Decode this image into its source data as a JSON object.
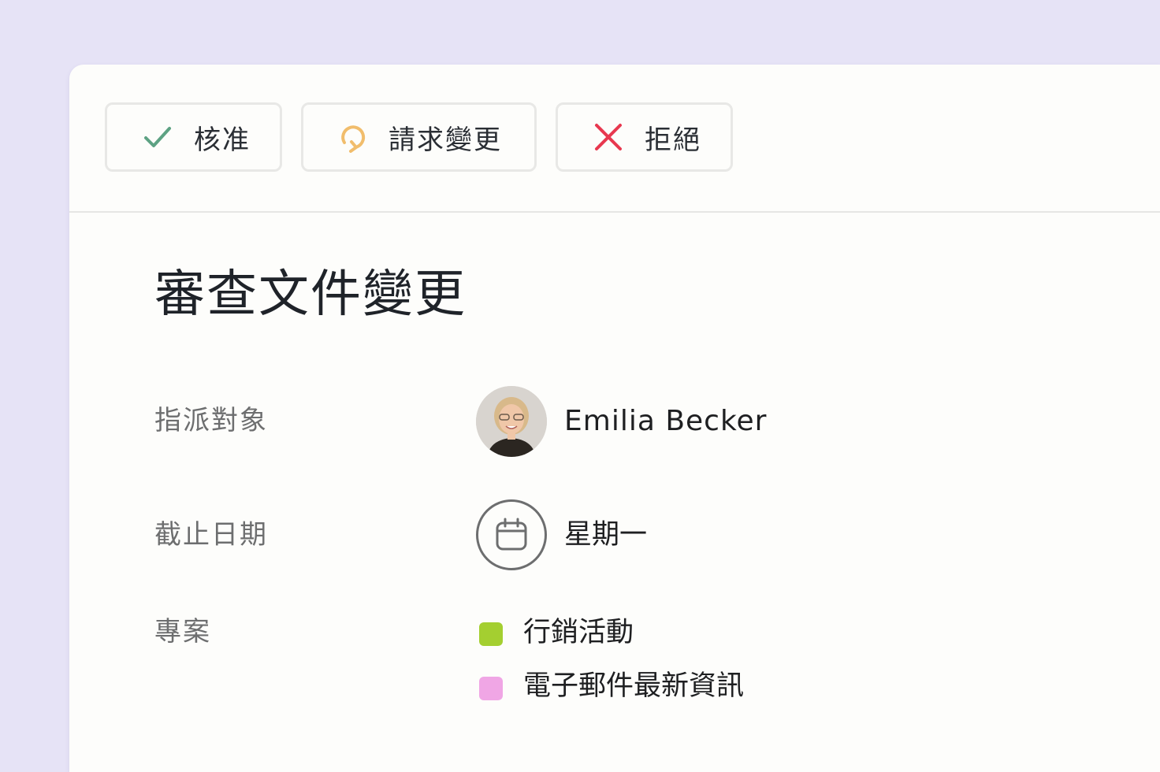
{
  "toolbar": {
    "approve_label": "核准",
    "approve_icon": "check-icon",
    "approve_color": "#5da283",
    "request_changes_label": "請求變更",
    "request_changes_icon": "refresh-icon",
    "request_changes_color": "#f1bd6c",
    "reject_label": "拒絕",
    "reject_icon": "close-icon",
    "reject_color": "#e8384f"
  },
  "task": {
    "title": "審查文件變更"
  },
  "fields": {
    "assignee_label": "指派對象",
    "assignee_name": "Emilia Becker",
    "due_date_label": "截止日期",
    "due_date_value": "星期一",
    "due_date_icon": "calendar-icon",
    "projects_label": "專案",
    "projects": [
      {
        "name": "行銷活動",
        "color": "#a4cf30"
      },
      {
        "name": "電子郵件最新資訊",
        "color": "#f0a6e5"
      }
    ]
  },
  "colors": {
    "page_background": "#e6e3f6",
    "card_background": "#fdfdfb"
  }
}
